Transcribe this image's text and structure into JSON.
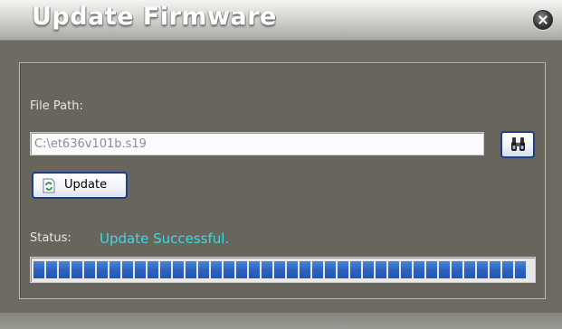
{
  "window": {
    "title": "Update Firmware",
    "close_icon": "close-icon"
  },
  "file_section": {
    "label": "File Path:",
    "path_value": "C:\\et636v101b.s19",
    "browse_icon": "binoculars-icon"
  },
  "update_button": {
    "icon": "refresh-icon",
    "label": "Update"
  },
  "status": {
    "label": "Status:",
    "value": "Update Successful."
  },
  "progress": {
    "percent": 100
  },
  "colors": {
    "window_bg": "#6c6a62",
    "status_text": "#3fd8e4",
    "progress_fill": "#2d64c0",
    "button_border": "#1d3f86"
  }
}
